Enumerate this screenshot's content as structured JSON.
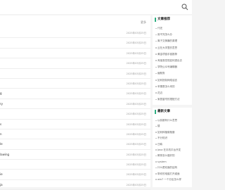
{
  "header": {
    "search_icon": "search-icon"
  },
  "main": {
    "more_label": "更多",
    "rows": [
      {
        "title": "",
        "date": "2025年03月25日"
      },
      {
        "title": "",
        "date": "2025年03月25日"
      },
      {
        "title": "",
        "date": "2025年03月25日"
      },
      {
        "title": "",
        "date": "2025年03月25日"
      },
      {
        "title": "",
        "date": "2025年03月25日"
      },
      {
        "title": "",
        "date": "2025年03月25日"
      },
      {
        "title": "g",
        "date": "2025年03月25日"
      },
      {
        "title": "ry",
        "date": "2025年03月25日"
      },
      {
        "title": "",
        "date": "2025年03月25日"
      },
      {
        "title": "s",
        "date": "2025年03月25日"
      },
      {
        "title": "n",
        "date": "2025年03月25日"
      },
      {
        "title": "le",
        "date": "2025年03月25日"
      },
      {
        "title": "lawing",
        "date": "2025年03月25日"
      },
      {
        "title": "",
        "date": "2025年03月25日"
      },
      {
        "title": "ie",
        "date": "2025年03月25日"
      },
      {
        "title": "ja",
        "date": "2025年03月25日"
      }
    ]
  },
  "sidebar": {
    "box1": {
      "title": "文章推荐",
      "items": [
        "代还",
        "用不完怎么办",
        "离子交换膜的原理",
        "云在大学里的意思",
        "黄金项链手链推荐",
        "淘宝首发现如何退出去",
        "学院公众号编辑器",
        "幽默鲁",
        "如何抵制网络谣言",
        "苹果是怎么来的",
        "花边",
        "家居窗帘的搭配方法"
      ]
    },
    "box2": {
      "title": "最新文章",
      "items": [
        "以前都有什么意思",
        "楼",
        "如何种植葡萄藤",
        "不分知识",
        "日韩",
        "Java 在手机平台开发",
        "教育怎么做好的",
        "system",
        "什么是双面的结构",
        "带你的电脑打开桌面",
        "win7 一个分区怎么样"
      ]
    }
  },
  "colors": {
    "accent": "#2eaf82",
    "background": "#f4f4f4"
  }
}
